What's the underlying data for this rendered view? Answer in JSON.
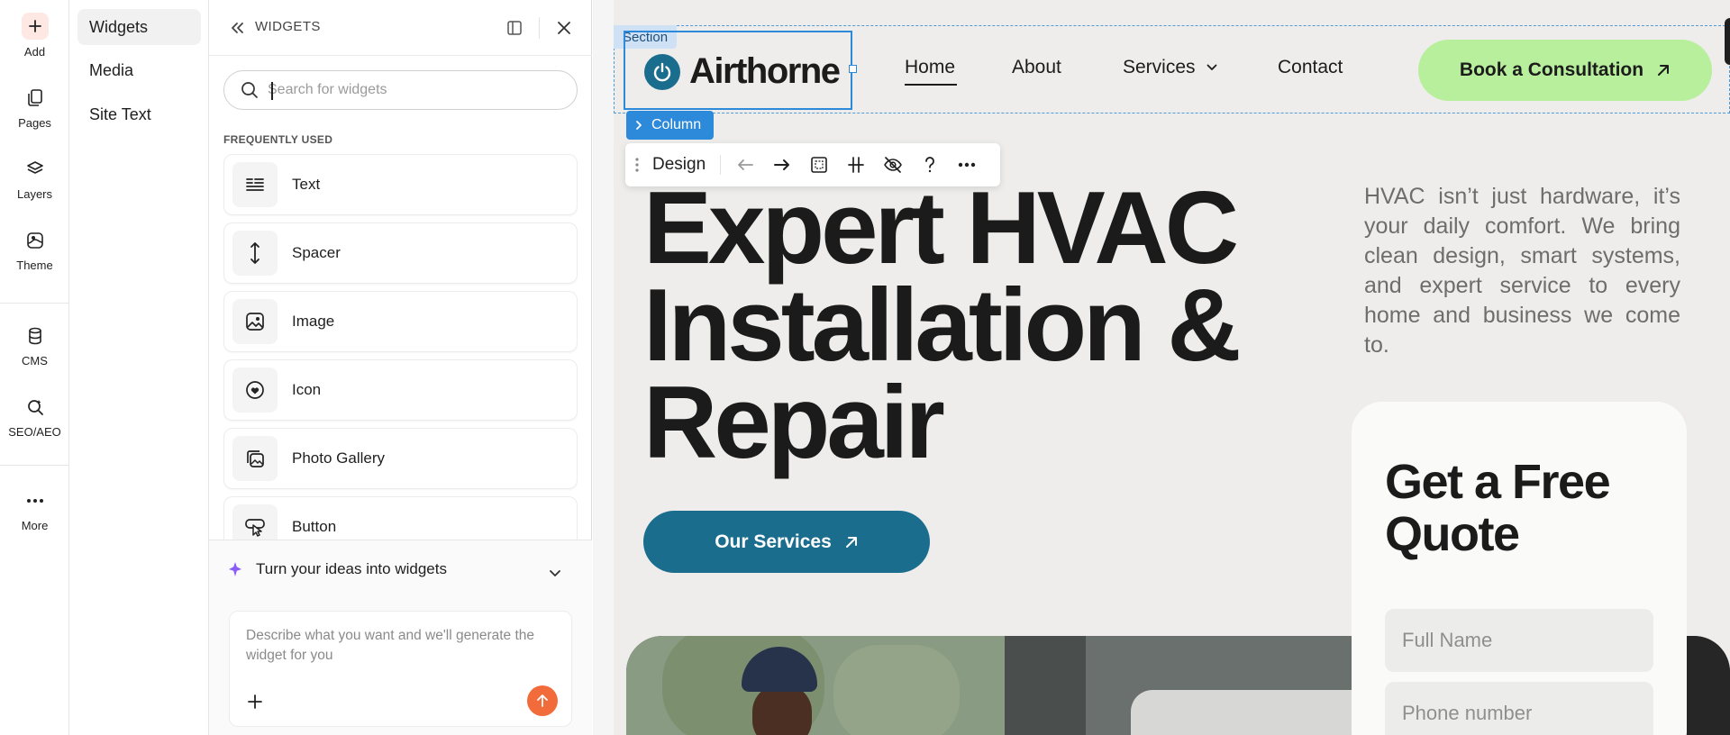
{
  "rail": {
    "items": [
      {
        "label": "Add",
        "icon": "plus-icon"
      },
      {
        "label": "Pages",
        "icon": "pages-icon"
      },
      {
        "label": "Layers",
        "icon": "layers-icon"
      },
      {
        "label": "Theme",
        "icon": "theme-icon"
      },
      {
        "label": "CMS",
        "icon": "database-icon"
      },
      {
        "label": "SEO/AEO",
        "icon": "seo-icon"
      },
      {
        "label": "More",
        "icon": "more-icon"
      }
    ]
  },
  "submenu": {
    "items": [
      {
        "label": "Widgets",
        "active": true
      },
      {
        "label": "Media",
        "active": false
      },
      {
        "label": "Site Text",
        "active": false
      }
    ]
  },
  "panel": {
    "title": "WIDGETS",
    "search_placeholder": "Search for widgets",
    "section_label": "FREQUENTLY USED",
    "widgets": [
      {
        "label": "Text",
        "icon": "text-align-icon"
      },
      {
        "label": "Spacer",
        "icon": "spacer-icon"
      },
      {
        "label": "Image",
        "icon": "image-icon"
      },
      {
        "label": "Icon",
        "icon": "heart-badge-icon"
      },
      {
        "label": "Photo Gallery",
        "icon": "gallery-icon"
      },
      {
        "label": "Button",
        "icon": "button-pointer-icon"
      }
    ],
    "ai": {
      "heading": "Turn your ideas into widgets",
      "placeholder": "Describe what you want and we'll generate the widget for you"
    }
  },
  "editor": {
    "section_tag": "Section",
    "column_tag": "Column",
    "toolbar_design": "Design"
  },
  "site": {
    "brand": "Airthorne",
    "nav": {
      "home": "Home",
      "about": "About",
      "services": "Services",
      "contact": "Contact"
    },
    "cta": "Book a Consultation",
    "hero": {
      "line1": "Expert HVAC",
      "line2": "Installation &",
      "line3": "Repair"
    },
    "description": "HVAC isn’t just hardware, it’s your daily comfort. We bring clean design, smart systems, and expert service to every home and business we come to.",
    "services_button": "Our Services",
    "quote": {
      "title": "Get a Free Quote",
      "full_name": "Full Name",
      "phone": "Phone number"
    }
  },
  "colors": {
    "brand_teal": "#1b6d8e",
    "cta_green": "#b8ef9c",
    "selection_blue": "#2d89d9",
    "send_orange": "#f26b3a"
  }
}
